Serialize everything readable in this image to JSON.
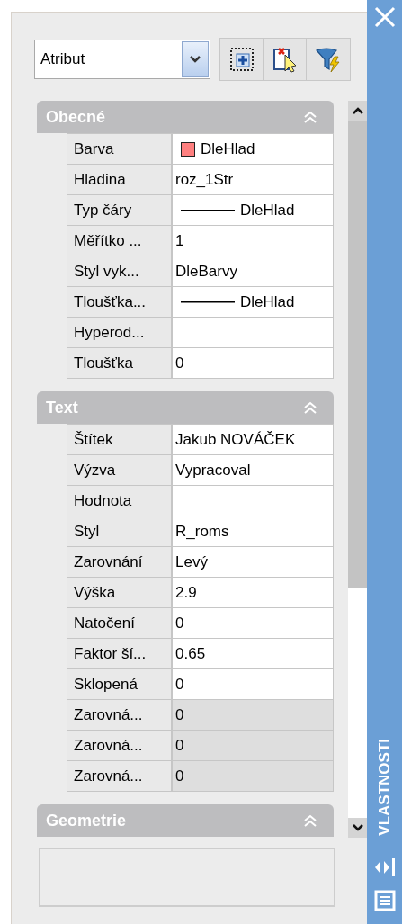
{
  "selector": {
    "value": "Atribut"
  },
  "sections": [
    {
      "title": "Obecné",
      "expanded": true,
      "rows": [
        {
          "label": "Barva",
          "value": "DleHlad",
          "kind": "color",
          "color": "#ff8080",
          "disabled": false
        },
        {
          "label": "Hladina",
          "value": "roz_1Str",
          "kind": "text",
          "disabled": false
        },
        {
          "label": "Typ čáry",
          "value": "DleHlad",
          "kind": "linetype",
          "disabled": false
        },
        {
          "label": "Měřítko ...",
          "value": "1",
          "kind": "text",
          "disabled": false
        },
        {
          "label": "Styl vyk...",
          "value": "DleBarvy",
          "kind": "text",
          "disabled": false
        },
        {
          "label": "Tloušťka...",
          "value": "DleHlad",
          "kind": "linetype",
          "disabled": false
        },
        {
          "label": "Hyperod...",
          "kind": "text",
          "disabled": false
        },
        {
          "label": "Tloušťka",
          "value": "0",
          "kind": "text",
          "disabled": false
        }
      ]
    },
    {
      "title": "Text",
      "expanded": true,
      "rows": [
        {
          "label": "Štítek",
          "value": "Jakub NOVÁČEK",
          "kind": "text",
          "disabled": false
        },
        {
          "label": "Výzva",
          "value": "Vypracoval",
          "kind": "text",
          "disabled": false
        },
        {
          "label": "Hodnota",
          "kind": "text",
          "disabled": false
        },
        {
          "label": "Styl",
          "value": "R_roms",
          "kind": "text",
          "disabled": false
        },
        {
          "label": "Zarovnání",
          "value": "Levý",
          "kind": "text",
          "disabled": false
        },
        {
          "label": "Výška",
          "value": "2.9",
          "kind": "text",
          "disabled": false
        },
        {
          "label": "Natočení",
          "value": "0",
          "kind": "text",
          "disabled": false
        },
        {
          "label": "Faktor ší...",
          "value": "0.65",
          "kind": "text",
          "disabled": false
        },
        {
          "label": "Sklopená",
          "value": "0",
          "kind": "text",
          "disabled": false
        },
        {
          "label": "Zarovná...",
          "value": "0",
          "kind": "text",
          "disabled": true
        },
        {
          "label": "Zarovná...",
          "value": "0",
          "kind": "text",
          "disabled": true
        },
        {
          "label": "Zarovná...",
          "value": "0",
          "kind": "text",
          "disabled": true
        }
      ]
    },
    {
      "title": "Geometrie",
      "expanded": true
    }
  ],
  "sidebar": {
    "title": "VLASTNOSTI"
  }
}
